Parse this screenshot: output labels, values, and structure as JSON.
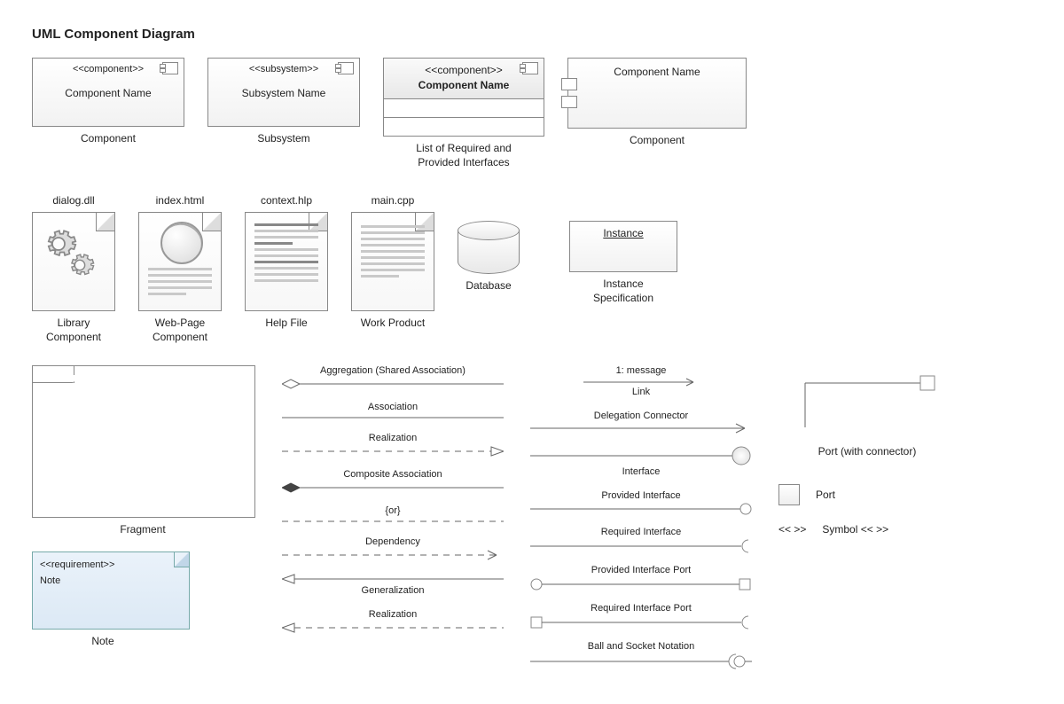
{
  "title": "UML Component Diagram",
  "row1": {
    "component": {
      "stereo": "<<component>>",
      "name": "Component Name",
      "caption": "Component"
    },
    "subsystem": {
      "stereo": "<<subsystem>>",
      "name": "Subsystem Name",
      "caption": "Subsystem"
    },
    "list": {
      "stereo": "<<component>>",
      "name": "Component Name",
      "caption": "List of Required and\nProvided Interfaces"
    },
    "portComp": {
      "name": "Component Name",
      "caption": "Component"
    }
  },
  "row2": {
    "lib": {
      "filename": "dialog.dll",
      "caption": "Library\nComponent"
    },
    "web": {
      "filename": "index.html",
      "caption": "Web-Page\nComponent"
    },
    "help": {
      "filename": "context.hlp",
      "caption": "Help File"
    },
    "work": {
      "filename": "main.cpp",
      "caption": "Work Product"
    },
    "db": {
      "caption": "Database"
    },
    "inst": {
      "name": "Instance",
      "caption": "Instance\nSpecification"
    }
  },
  "fragment_caption": "Fragment",
  "note": {
    "stereo": "<<requirement>>",
    "text": "Note",
    "caption": "Note"
  },
  "left_connectors": [
    {
      "id": "aggregation",
      "label": "Aggregation (Shared Association)"
    },
    {
      "id": "association",
      "label": "Association"
    },
    {
      "id": "realization",
      "label": "Realization"
    },
    {
      "id": "composite",
      "label": "Composite Association"
    },
    {
      "id": "or",
      "label": "{or}"
    },
    {
      "id": "dependency",
      "label": "Dependency"
    },
    {
      "id": "generalization",
      "label": "Generalization"
    },
    {
      "id": "realization2",
      "label": "Realization"
    }
  ],
  "right_connectors": [
    {
      "id": "link",
      "label": "1: message",
      "sublabel": "Link"
    },
    {
      "id": "delegation",
      "label": "Delegation Connector"
    },
    {
      "id": "interface",
      "label": "Interface"
    },
    {
      "id": "provided",
      "label": "Provided Interface"
    },
    {
      "id": "required",
      "label": "Required Interface"
    },
    {
      "id": "provided-port",
      "label": "Provided Interface Port"
    },
    {
      "id": "required-port",
      "label": "Required Interface Port"
    },
    {
      "id": "ballsocket",
      "label": "Ball and Socket Notation"
    }
  ],
  "side": {
    "port_conn": "Port (with connector)",
    "port": "Port",
    "symbol_left": "<< >>",
    "symbol_right": "Symbol << >>"
  }
}
